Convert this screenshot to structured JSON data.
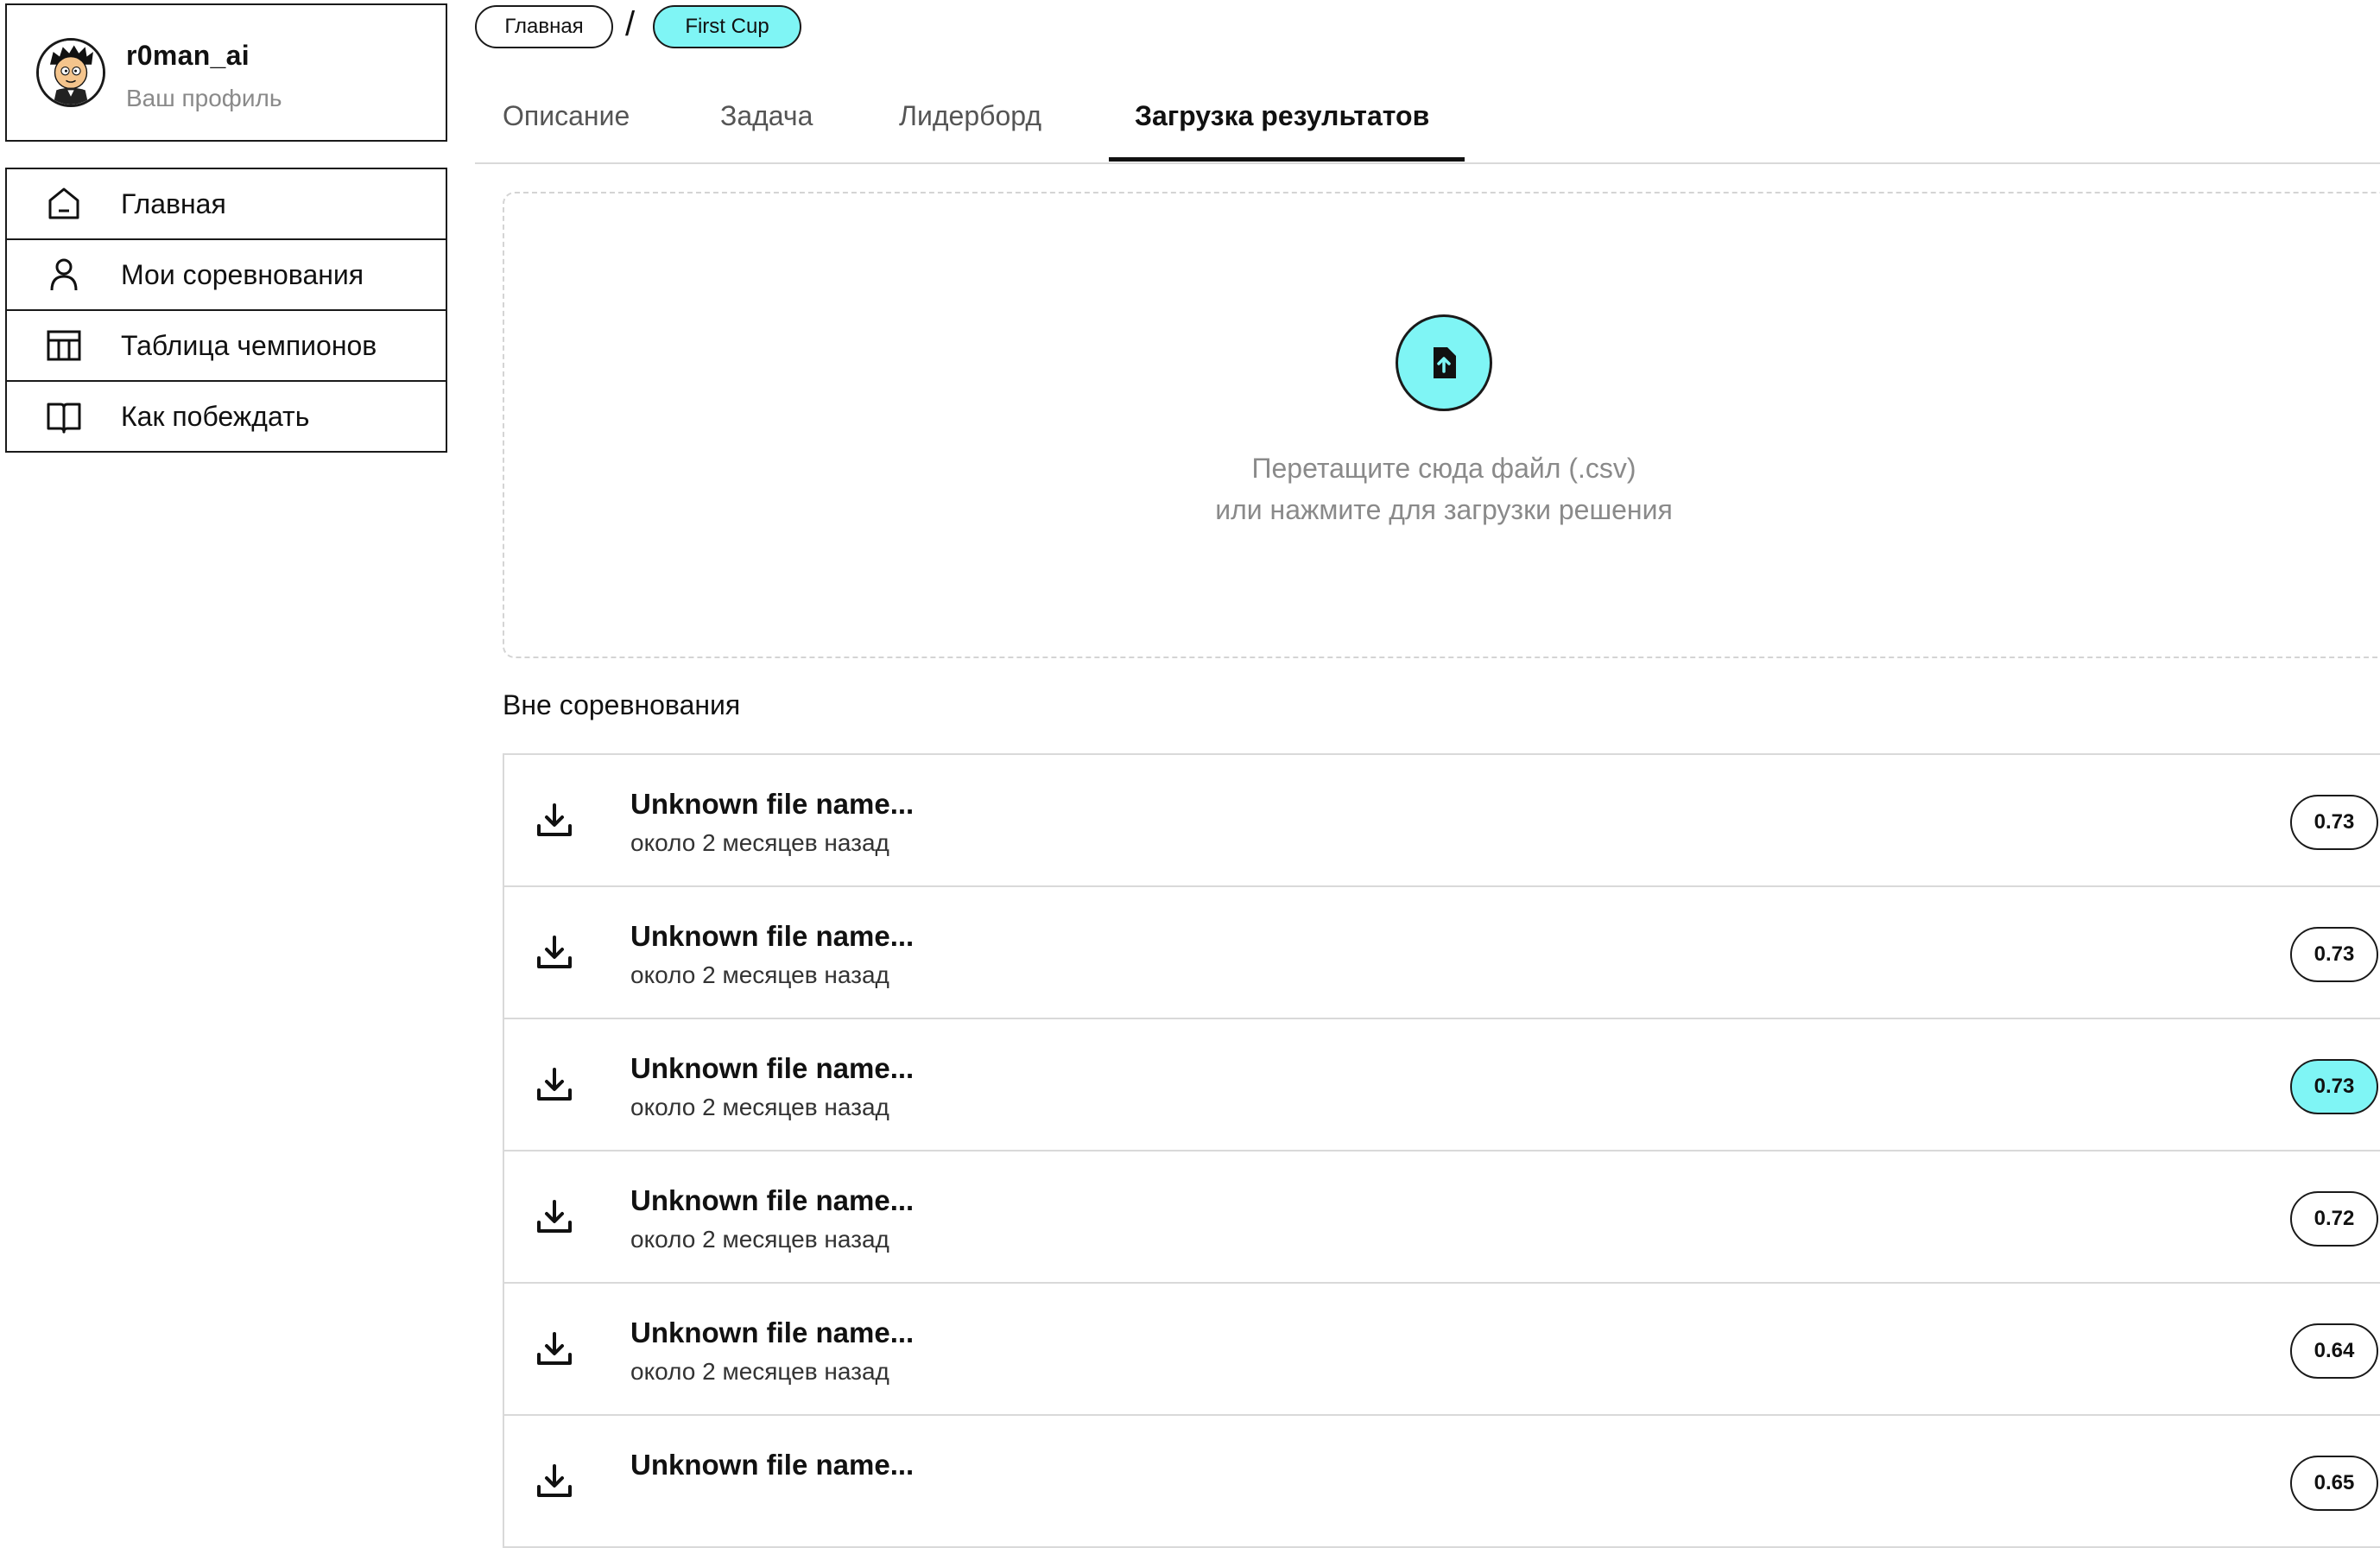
{
  "profile": {
    "username": "r0man_ai",
    "subtitle": "Ваш профиль"
  },
  "sidebar": {
    "items": [
      {
        "label": "Главная",
        "icon": "home-icon"
      },
      {
        "label": "Мои соревнования",
        "icon": "user-icon"
      },
      {
        "label": "Таблица чемпионов",
        "icon": "table-icon"
      },
      {
        "label": "Как побеждать",
        "icon": "book-icon"
      }
    ]
  },
  "breadcrumb": {
    "home": "Главная",
    "separator": "/",
    "current": "First Cup"
  },
  "tabs": [
    {
      "label": "Описание"
    },
    {
      "label": "Задача"
    },
    {
      "label": "Лидерборд"
    },
    {
      "label": "Загрузка результатов",
      "active": true
    }
  ],
  "upload": {
    "icon": "file-upload-icon",
    "line1": "Перетащите сюда файл (.csv)",
    "line2": "или нажмите для загрузки решения"
  },
  "section_title": "Вне соревнования",
  "submissions": [
    {
      "name": "Unknown file name...",
      "time": "около 2 месяцев назад",
      "score": "0.73",
      "highlighted": false
    },
    {
      "name": "Unknown file name...",
      "time": "около 2 месяцев назад",
      "score": "0.73",
      "highlighted": false
    },
    {
      "name": "Unknown file name...",
      "time": "около 2 месяцев назад",
      "score": "0.73",
      "highlighted": true
    },
    {
      "name": "Unknown file name...",
      "time": "около 2 месяцев назад",
      "score": "0.72",
      "highlighted": false
    },
    {
      "name": "Unknown file name...",
      "time": "около 2 месяцев назад",
      "score": "0.64",
      "highlighted": false
    },
    {
      "name": "Unknown file name...",
      "time": "",
      "score": "0.65",
      "highlighted": false
    }
  ],
  "colors": {
    "accent": "#7ff5f5",
    "border": "#1a1a1a",
    "muted": "#8a8a8a"
  }
}
